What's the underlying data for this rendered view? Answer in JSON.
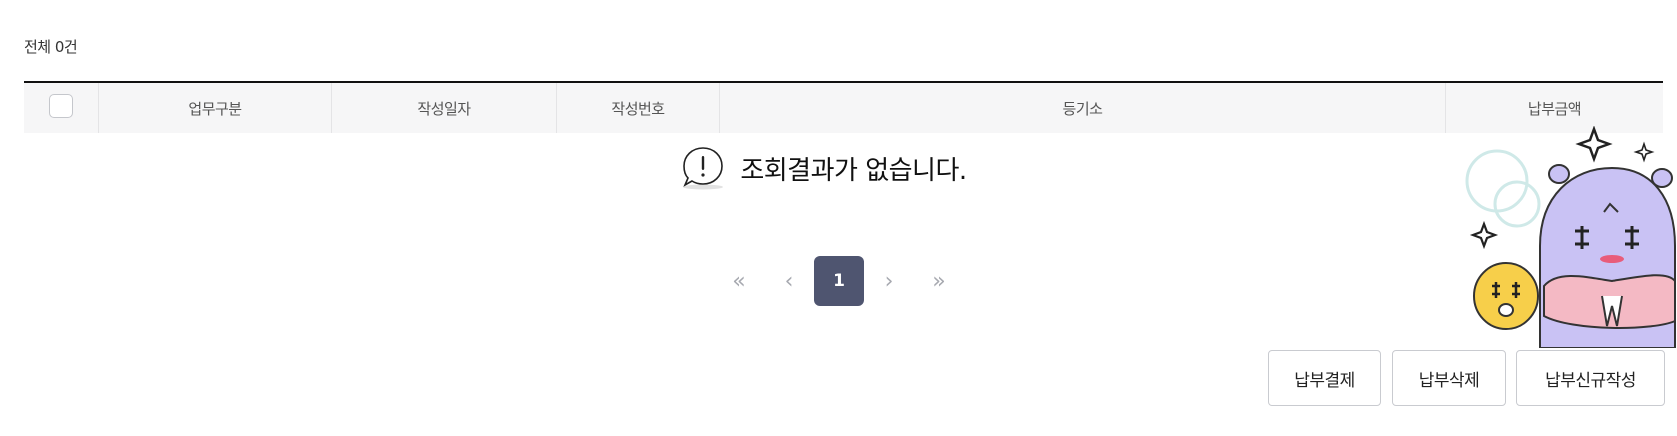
{
  "summary": {
    "total_label": "전체 0건"
  },
  "table": {
    "columns": [
      "업무구분",
      "작성일자",
      "작성번호",
      "등기소",
      "납부금액"
    ],
    "rows": [],
    "empty_message": "조회결과가 없습니다."
  },
  "pagination": {
    "first": "«",
    "prev": "‹",
    "current_page": "1",
    "next": "›",
    "last": "»"
  },
  "actions": {
    "pay_label": "납부결제",
    "delete_label": "납부삭제",
    "new_label": "납부신규작성"
  },
  "icons": {
    "empty": "alert-speech-bubble-icon",
    "mascot": "character-sticker-icon"
  },
  "colors": {
    "header_border": "#111111",
    "header_bg": "#f6f6f7",
    "current_page_bg": "#4f5570",
    "button_border": "#c9cbd0"
  }
}
